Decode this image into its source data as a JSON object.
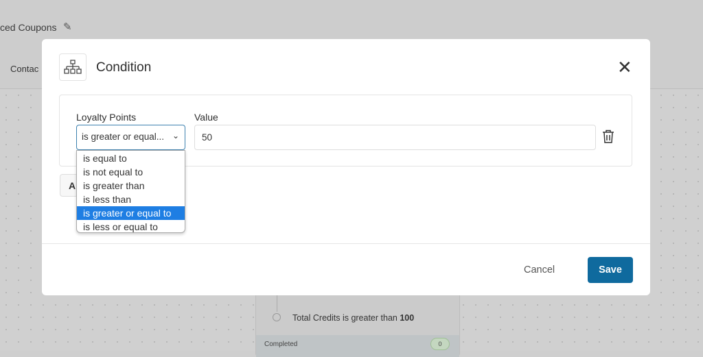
{
  "background": {
    "breadcrumb": "ced Coupons",
    "tab_partial": "Contac",
    "node_condition": {
      "prefix": "Total Credits is greater than ",
      "value": "100"
    },
    "node_status": "Completed",
    "node_count": "0"
  },
  "modal": {
    "title": "Condition",
    "field_label": "Loyalty Points",
    "value_label": "Value",
    "operator_selected": "is greater or equal...",
    "value": "50",
    "add_button_partial": "A",
    "cancel_label": "Cancel",
    "save_label": "Save",
    "accent_color": "#0f6a9e"
  },
  "dropdown": {
    "options": [
      "is equal to",
      "is not equal to",
      "is greater than",
      "is less than",
      "is greater or equal to",
      "is less or equal to"
    ],
    "selected_index": 4
  }
}
